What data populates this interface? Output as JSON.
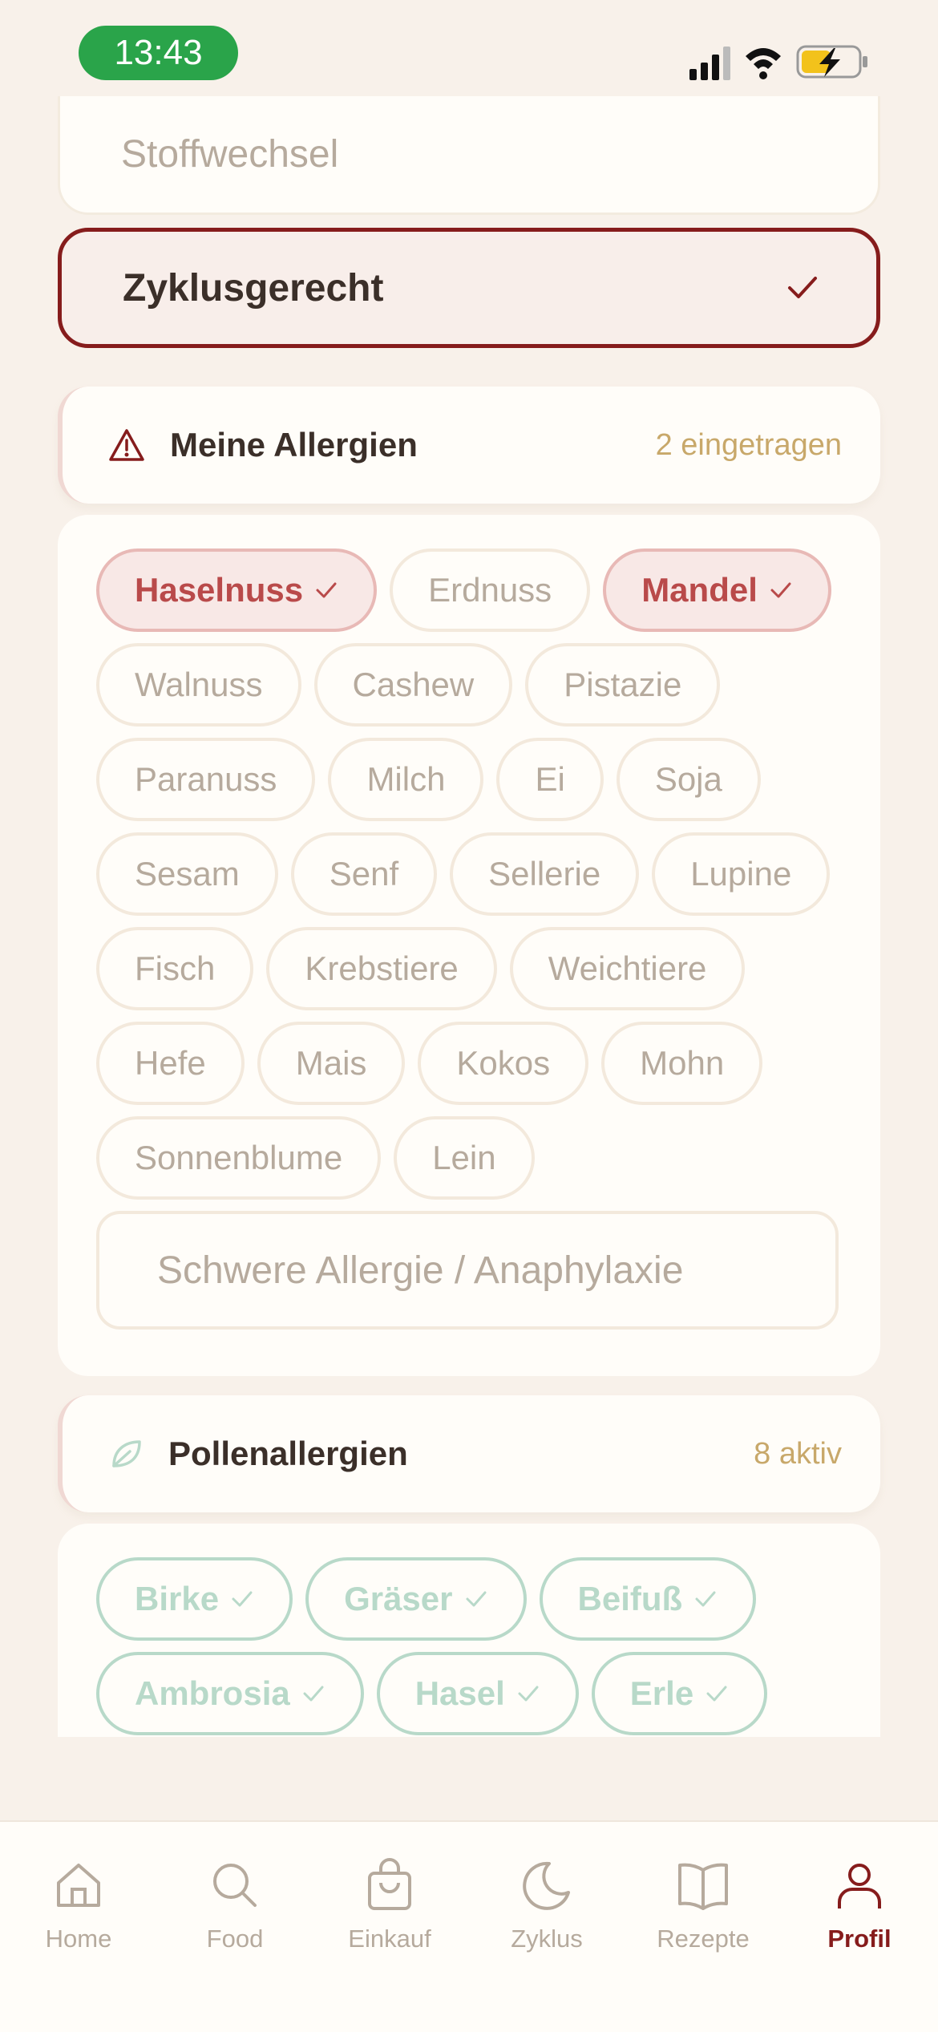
{
  "status_bar": {
    "time": "13:43"
  },
  "diet_options": {
    "top_label": "Stoffwechsel",
    "selected_label": "Zyklusgerecht"
  },
  "allergies": {
    "title": "Meine Allergien",
    "count": "2 eingetragen",
    "rows": [
      [
        {
          "label": "Haselnuss",
          "selected": true
        },
        {
          "label": "Erdnuss",
          "selected": false
        },
        {
          "label": "Mandel",
          "selected": true
        }
      ],
      [
        {
          "label": "Walnuss",
          "selected": false
        },
        {
          "label": "Cashew",
          "selected": false
        },
        {
          "label": "Pistazie",
          "selected": false
        }
      ],
      [
        {
          "label": "Paranuss",
          "selected": false
        },
        {
          "label": "Milch",
          "selected": false
        },
        {
          "label": "Ei",
          "selected": false
        },
        {
          "label": "Soja",
          "selected": false
        }
      ],
      [
        {
          "label": "Sesam",
          "selected": false
        },
        {
          "label": "Senf",
          "selected": false
        },
        {
          "label": "Sellerie",
          "selected": false
        },
        {
          "label": "Lupine",
          "selected": false
        }
      ],
      [
        {
          "label": "Fisch",
          "selected": false
        },
        {
          "label": "Krebstiere",
          "selected": false
        },
        {
          "label": "Weichtiere",
          "selected": false
        }
      ],
      [
        {
          "label": "Hefe",
          "selected": false
        },
        {
          "label": "Mais",
          "selected": false
        },
        {
          "label": "Kokos",
          "selected": false
        },
        {
          "label": "Mohn",
          "selected": false
        }
      ],
      [
        {
          "label": "Sonnenblume",
          "selected": false
        },
        {
          "label": "Lein",
          "selected": false
        }
      ]
    ],
    "severe_label": "Schwere Allergie / Anaphylaxie"
  },
  "pollen": {
    "title": "Pollenallergien",
    "count": "8 aktiv",
    "rows": [
      [
        {
          "label": "Birke"
        },
        {
          "label": "Gräser"
        },
        {
          "label": "Beifuß"
        }
      ],
      [
        {
          "label": "Ambrosia"
        },
        {
          "label": "Hasel"
        },
        {
          "label": "Erle"
        }
      ]
    ]
  },
  "tabs": [
    {
      "label": "Home",
      "icon": "home-icon"
    },
    {
      "label": "Food",
      "icon": "search-icon"
    },
    {
      "label": "Einkauf",
      "icon": "shopping-bag-icon"
    },
    {
      "label": "Zyklus",
      "icon": "moon-icon"
    },
    {
      "label": "Rezepte",
      "icon": "book-icon"
    },
    {
      "label": "Profil",
      "icon": "user-icon"
    }
  ],
  "colors": {
    "accent": "#861c1c",
    "selected_chip_text": "#b94a4a",
    "count_gold": "#c8a86a",
    "pollen_green": "#b8d9c9",
    "time_pill": "#2aa44a"
  }
}
